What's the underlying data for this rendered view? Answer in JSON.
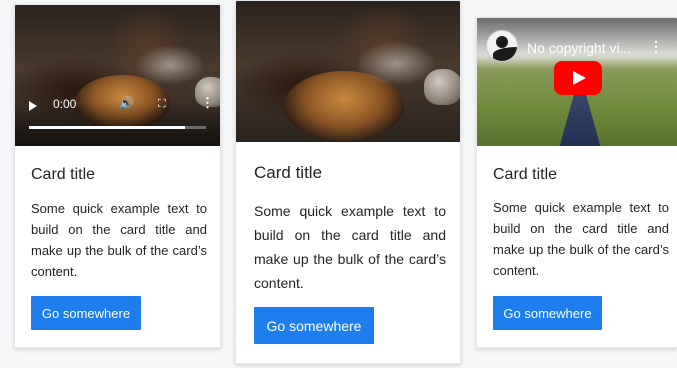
{
  "cards": [
    {
      "title": "Card title",
      "text": "Some quick example text to build on the card title and make up the bulk of the card’s content.",
      "button_label": "Go somewhere",
      "media": {
        "type": "video-player",
        "time": "0:00",
        "progress_fraction": 0.88
      }
    },
    {
      "title": "Card title",
      "text": "Some quick example text to build on the card title and make up the bulk of the card’s content.",
      "button_label": "Go somewhere",
      "media": {
        "type": "image"
      }
    },
    {
      "title": "Card title",
      "text": "Some quick example text to build on the card title and make up the bulk of the card’s content.",
      "button_label": "Go somewhere",
      "media": {
        "type": "youtube-embed",
        "video_title": "No copyright vi..."
      }
    }
  ],
  "colors": {
    "button_bg": "#1d7dec",
    "button_text": "#ffffff",
    "youtube_red": "#ff0000",
    "card_bg": "#ffffff",
    "text": "#212529"
  },
  "icons": {
    "player": [
      "play-icon",
      "volume-icon",
      "fullscreen-icon",
      "more-options-icon"
    ],
    "youtube": [
      "channel-avatar-icon",
      "youtube-play-icon",
      "more-options-icon"
    ]
  }
}
